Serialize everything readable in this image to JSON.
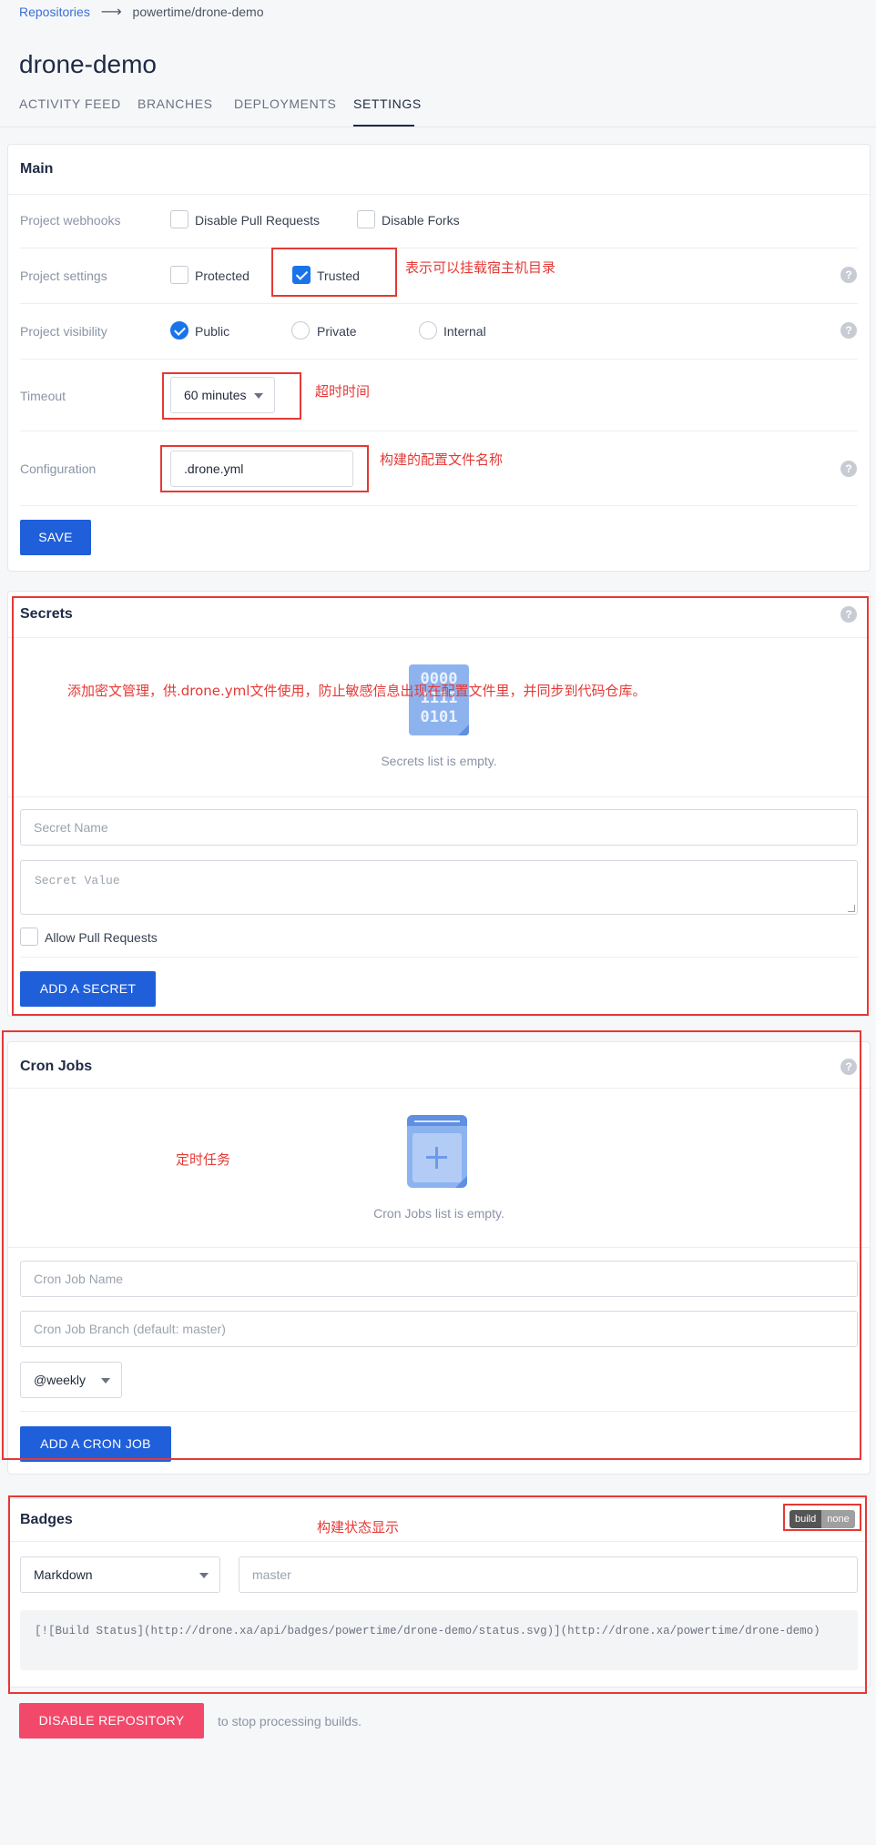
{
  "breadcrumb": {
    "root": "Repositories",
    "arrow": "⟶",
    "path": "powertime/drone-demo"
  },
  "repo_title": "drone-demo",
  "tabs": [
    {
      "label": "ACTIVITY FEED",
      "active": false
    },
    {
      "label": "BRANCHES",
      "active": false
    },
    {
      "label": "DEPLOYMENTS",
      "active": false
    },
    {
      "label": "SETTINGS",
      "active": true
    }
  ],
  "main": {
    "title": "Main",
    "webhooks_label": "Project webhooks",
    "disable_pr_label": "Disable Pull Requests",
    "disable_pr_checked": false,
    "disable_forks_label": "Disable Forks",
    "disable_forks_checked": false,
    "settings_label": "Project settings",
    "protected_label": "Protected",
    "protected_checked": false,
    "trusted_label": "Trusted",
    "trusted_checked": true,
    "visibility_label": "Project visibility",
    "visibility_options": [
      "Public",
      "Private",
      "Internal"
    ],
    "visibility_selected": "Public",
    "timeout_label": "Timeout",
    "timeout_value": "60 minutes",
    "config_label": "Configuration",
    "config_value": ".drone.yml",
    "save_label": "SAVE",
    "help_glyph": "?"
  },
  "secrets": {
    "title": "Secrets",
    "icon_text": [
      "0000",
      "1111",
      "0101"
    ],
    "empty_text": "Secrets list is empty.",
    "name_placeholder": "Secret Name",
    "value_placeholder": "Secret Value",
    "allow_pr_label": "Allow Pull Requests",
    "allow_pr_checked": false,
    "add_label": "ADD A SECRET"
  },
  "cron": {
    "title": "Cron Jobs",
    "empty_text": "Cron Jobs list is empty.",
    "name_placeholder": "Cron Job Name",
    "branch_placeholder": "Cron Job Branch (default: master)",
    "schedule_value": "@weekly",
    "add_label": "ADD A CRON JOB"
  },
  "badges": {
    "title": "Badges",
    "badge_left": "build",
    "badge_right": "none",
    "format_value": "Markdown",
    "branch_placeholder": "master",
    "code": "[![Build Status](http://drone.xa/api/badges/powertime/drone-demo/status.svg)](http://drone.xa/powertime/drone-demo)"
  },
  "footer": {
    "disable_label": "DISABLE REPOSITORY",
    "disable_hint": "to stop processing builds."
  },
  "annotations": {
    "trusted_note": "表示可以挂载宿主机目录",
    "timeout_note": "超时时间",
    "config_note": "构建的配置文件名称",
    "secrets_note": "添加密文管理，供.drone.yml文件使用，防止敏感信息出现在配置文件里，并同步到代码仓库。",
    "cron_note": "定时任务",
    "badges_note": "构建状态显示"
  },
  "colors": {
    "primary": "#1f5fd9",
    "danger": "#f2496a",
    "annotation": "#e53935",
    "check": "#1a73e8"
  }
}
